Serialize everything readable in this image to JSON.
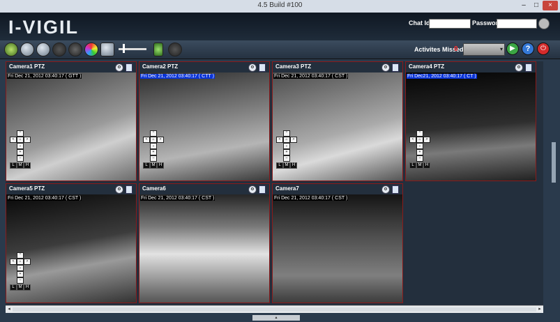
{
  "window": {
    "title": "4.5 Build #100",
    "minimize_label": "–",
    "maximize_label": "□",
    "close_label": "×"
  },
  "header": {
    "logo": "I-VIGIL",
    "chat_id_label": "Chat Id :",
    "chat_id_value": "",
    "password_label": "Password :",
    "password_value": ""
  },
  "toolbar": {
    "icons": [
      "camera-icon",
      "settings-icon",
      "network-icon",
      "grid-icon",
      "ptz-icon",
      "color-wheel-icon",
      "monitor-icon",
      "slider",
      "microphone-icon",
      "keyboard-icon"
    ],
    "activities_missed_label": "Activites Missed:",
    "activities_missed_count": "0",
    "combo_value": "▾"
  },
  "cameras": [
    {
      "name": "Camera1 PTZ",
      "stamp": "Fri Dec 21, 2012 03:40:17 ( GTT )",
      "selected": false,
      "ptz": true
    },
    {
      "name": "Camera2 PTZ",
      "stamp": "Fri Dec 21, 2012 03:40:17 ( CTT )",
      "selected": true,
      "ptz": true
    },
    {
      "name": "Camera3 PTZ",
      "stamp": "Fri Dec 21, 2012 03:40:17 ( CST )",
      "selected": false,
      "ptz": true
    },
    {
      "name": "Camera4 PTZ",
      "stamp": "Fri Dec21, 2012 03:40:17 ( CT )",
      "selected": true,
      "ptz": true
    },
    {
      "name": "Camera5 PTZ",
      "stamp": "Fri Dec 21, 2012 03:40:17 ( CST )",
      "selected": false,
      "ptz": true
    },
    {
      "name": "Camera6",
      "stamp": "Fri Dec 21, 2012 03:40:17 ( CST )",
      "selected": false,
      "ptz": false
    },
    {
      "name": "Camera7",
      "stamp": "Fri Dec 21, 2012 03:40:17 ( CST )",
      "selected": false,
      "ptz": false
    }
  ],
  "ptz_controls": {
    "up": "⌃",
    "left": "<",
    "home": "⌂",
    "right": ">",
    "down": "⌄",
    "plus": "+",
    "minus": "–",
    "l": "L",
    "m": "M",
    "h": "H"
  },
  "scroll": {
    "left": "◂",
    "right": "▸"
  },
  "bottom_tab": "▴"
}
